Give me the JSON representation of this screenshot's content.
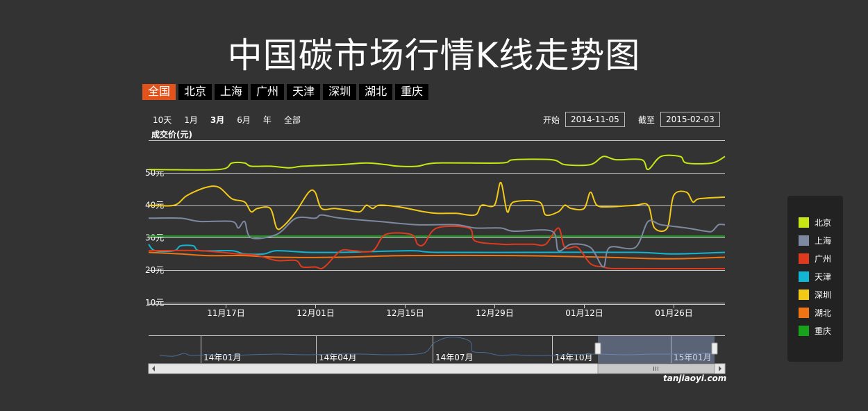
{
  "title": "中国碳市场行情K线走势图",
  "tabs": [
    "全国",
    "北京",
    "上海",
    "广州",
    "天津",
    "深圳",
    "湖北",
    "重庆"
  ],
  "active_tab": "全国",
  "ranges": [
    "10天",
    "1月",
    "3月",
    "6月",
    "年",
    "全部"
  ],
  "selected_range": "3月",
  "start_label": "开始",
  "start_date": "2014-11-05",
  "end_label": "截至",
  "end_date": "2015-02-03",
  "watermark": "tanjiaoyi.com",
  "chart_data": {
    "type": "line",
    "ylabel": "成交价(元)",
    "y_ticks": [
      10,
      20,
      30,
      40,
      50
    ],
    "y_tick_suffix": "元",
    "ylim": [
      10,
      60
    ],
    "xlim": [
      "2014-11-05",
      "2015-02-03"
    ],
    "x_ticks": [
      {
        "date": "2014-11-17",
        "label": "11月17日"
      },
      {
        "date": "2014-12-01",
        "label": "12月01日"
      },
      {
        "date": "2014-12-15",
        "label": "12月15日"
      },
      {
        "date": "2014-12-29",
        "label": "12月29日"
      },
      {
        "date": "2015-01-12",
        "label": "01月12日"
      },
      {
        "date": "2015-01-26",
        "label": "01月26日"
      }
    ],
    "grid": true,
    "legend_position": "right",
    "series": [
      {
        "name": "北京",
        "color": "#c8e614",
        "points": [
          [
            "2014-11-05",
            51
          ],
          [
            "2014-11-16",
            51
          ],
          [
            "2014-11-18",
            53
          ],
          [
            "2014-11-20",
            53
          ],
          [
            "2014-11-21",
            52
          ],
          [
            "2014-11-24",
            52
          ],
          [
            "2014-11-27",
            51.5
          ],
          [
            "2014-11-29",
            52
          ],
          [
            "2014-12-05",
            52.5
          ],
          [
            "2014-12-09",
            53
          ],
          [
            "2014-12-12",
            52.5
          ],
          [
            "2014-12-14",
            52
          ],
          [
            "2014-12-17",
            52
          ],
          [
            "2014-12-20",
            53
          ],
          [
            "2014-12-30",
            53
          ],
          [
            "2015-01-01",
            54
          ],
          [
            "2015-01-07",
            54
          ],
          [
            "2015-01-09",
            52.5
          ],
          [
            "2015-01-13",
            52.5
          ],
          [
            "2015-01-15",
            55
          ],
          [
            "2015-01-17",
            54
          ],
          [
            "2015-01-21",
            54
          ],
          [
            "2015-01-22",
            51
          ],
          [
            "2015-01-24",
            55
          ],
          [
            "2015-01-27",
            55
          ],
          [
            "2015-01-28",
            53
          ],
          [
            "2015-02-01",
            53
          ],
          [
            "2015-02-03",
            55
          ]
        ]
      },
      {
        "name": "上海",
        "color": "#7d89a1",
        "points": [
          [
            "2014-11-05",
            36
          ],
          [
            "2014-11-10",
            36
          ],
          [
            "2014-11-13",
            35
          ],
          [
            "2014-11-18",
            35
          ],
          [
            "2014-11-19",
            33
          ],
          [
            "2014-11-20",
            35
          ],
          [
            "2014-11-21",
            30
          ],
          [
            "2014-11-25",
            31
          ],
          [
            "2014-11-28",
            36
          ],
          [
            "2014-12-01",
            36
          ],
          [
            "2014-12-02",
            37
          ],
          [
            "2014-12-05",
            36
          ],
          [
            "2014-12-11",
            35
          ],
          [
            "2014-12-17",
            34
          ],
          [
            "2014-12-23",
            34
          ],
          [
            "2014-12-26",
            33
          ],
          [
            "2014-12-30",
            33
          ],
          [
            "2015-01-01",
            32
          ],
          [
            "2015-01-07",
            32
          ],
          [
            "2015-01-08",
            26
          ],
          [
            "2015-01-10",
            28
          ],
          [
            "2015-01-13",
            27
          ],
          [
            "2015-01-15",
            21
          ],
          [
            "2015-01-16",
            27
          ],
          [
            "2015-01-20",
            27
          ],
          [
            "2015-01-22",
            35
          ],
          [
            "2015-01-24",
            34
          ],
          [
            "2015-01-28",
            33
          ],
          [
            "2015-01-31",
            32
          ],
          [
            "2015-02-01",
            32
          ],
          [
            "2015-02-02",
            34
          ],
          [
            "2015-02-03",
            34
          ]
        ]
      },
      {
        "name": "广州",
        "color": "#e03a1e",
        "points": [
          [
            "2014-11-05",
            26
          ],
          [
            "2014-11-13",
            26
          ],
          [
            "2014-11-19",
            25
          ],
          [
            "2014-11-22",
            24.5
          ],
          [
            "2014-11-25",
            23
          ],
          [
            "2014-11-28",
            23
          ],
          [
            "2014-11-29",
            21
          ],
          [
            "2014-12-01",
            21
          ],
          [
            "2014-12-02",
            20.5
          ],
          [
            "2014-12-03",
            22
          ],
          [
            "2014-12-05",
            26
          ],
          [
            "2014-12-07",
            26
          ],
          [
            "2014-12-10",
            26
          ],
          [
            "2014-12-12",
            31
          ],
          [
            "2014-12-16",
            31
          ],
          [
            "2014-12-17",
            28
          ],
          [
            "2014-12-18",
            28
          ],
          [
            "2014-12-20",
            33
          ],
          [
            "2014-12-25",
            33
          ],
          [
            "2014-12-26",
            29
          ],
          [
            "2014-12-30",
            28
          ],
          [
            "2015-01-01",
            28
          ],
          [
            "2015-01-04",
            28
          ],
          [
            "2015-01-06",
            28
          ],
          [
            "2015-01-08",
            33
          ],
          [
            "2015-01-09",
            27
          ],
          [
            "2015-01-11",
            27
          ],
          [
            "2015-01-13",
            22
          ],
          [
            "2015-01-15",
            21
          ],
          [
            "2015-01-17",
            20.5
          ],
          [
            "2015-02-03",
            20.5
          ]
        ]
      },
      {
        "name": "天津",
        "color": "#12b5d2",
        "points": [
          [
            "2014-11-05",
            28
          ],
          [
            "2014-11-06",
            26
          ],
          [
            "2014-11-09",
            26
          ],
          [
            "2014-11-10",
            27.5
          ],
          [
            "2014-11-12",
            27.5
          ],
          [
            "2014-11-13",
            26
          ],
          [
            "2014-11-18",
            26
          ],
          [
            "2014-11-20",
            25
          ],
          [
            "2014-11-23",
            25
          ],
          [
            "2014-11-25",
            26
          ],
          [
            "2014-11-30",
            25.5
          ],
          [
            "2014-12-05",
            25.5
          ],
          [
            "2014-12-16",
            26
          ],
          [
            "2014-12-20",
            25.5
          ],
          [
            "2015-01-05",
            25.5
          ],
          [
            "2015-01-20",
            25.5
          ],
          [
            "2015-01-26",
            25
          ],
          [
            "2015-02-03",
            25.5
          ]
        ]
      },
      {
        "name": "深圳",
        "color": "#f3c918",
        "points": [
          [
            "2014-11-05",
            40
          ],
          [
            "2014-11-09",
            40
          ],
          [
            "2014-11-11",
            43
          ],
          [
            "2014-11-14",
            45.5
          ],
          [
            "2014-11-16",
            45.5
          ],
          [
            "2014-11-18",
            42
          ],
          [
            "2014-11-20",
            41
          ],
          [
            "2014-11-21",
            38
          ],
          [
            "2014-11-22",
            39
          ],
          [
            "2014-11-24",
            39
          ],
          [
            "2014-11-25",
            33
          ],
          [
            "2014-11-26",
            33.5
          ],
          [
            "2014-11-28",
            38
          ],
          [
            "2014-11-30",
            44
          ],
          [
            "2014-12-01",
            44
          ],
          [
            "2014-12-02",
            39
          ],
          [
            "2014-12-04",
            39
          ],
          [
            "2014-12-06",
            38.5
          ],
          [
            "2014-12-08",
            38
          ],
          [
            "2014-12-09",
            40
          ],
          [
            "2014-12-10",
            39
          ],
          [
            "2014-12-11",
            40
          ],
          [
            "2014-12-14",
            39.5
          ],
          [
            "2014-12-18",
            38
          ],
          [
            "2014-12-20",
            37.5
          ],
          [
            "2014-12-23",
            37.5
          ],
          [
            "2014-12-26",
            37
          ],
          [
            "2014-12-27",
            40
          ],
          [
            "2014-12-29",
            40
          ],
          [
            "2014-12-30",
            47
          ],
          [
            "2014-12-31",
            38
          ],
          [
            "2015-01-01",
            41
          ],
          [
            "2015-01-05",
            41
          ],
          [
            "2015-01-06",
            37
          ],
          [
            "2015-01-08",
            38
          ],
          [
            "2015-01-09",
            40
          ],
          [
            "2015-01-10",
            39
          ],
          [
            "2015-01-12",
            39
          ],
          [
            "2015-01-13",
            44
          ],
          [
            "2015-01-14",
            40
          ],
          [
            "2015-01-16",
            39.5
          ],
          [
            "2015-01-20",
            40
          ],
          [
            "2015-01-22",
            40
          ],
          [
            "2015-01-23",
            33
          ],
          [
            "2015-01-25",
            33
          ],
          [
            "2015-01-26",
            43
          ],
          [
            "2015-01-28",
            44
          ],
          [
            "2015-01-29",
            41
          ],
          [
            "2015-01-30",
            42
          ],
          [
            "2015-02-03",
            42.5
          ]
        ]
      },
      {
        "name": "湖北",
        "color": "#f07314",
        "points": [
          [
            "2014-11-05",
            25.5
          ],
          [
            "2014-11-10",
            25
          ],
          [
            "2014-11-14",
            24.5
          ],
          [
            "2014-11-20",
            24.5
          ],
          [
            "2014-11-25",
            24
          ],
          [
            "2014-12-05",
            24
          ],
          [
            "2014-12-15",
            24.5
          ],
          [
            "2015-01-01",
            24.5
          ],
          [
            "2015-01-15",
            24
          ],
          [
            "2015-01-25",
            23.5
          ],
          [
            "2015-02-03",
            24
          ]
        ]
      },
      {
        "name": "重庆",
        "color": "#18a11a",
        "points": [
          [
            "2014-11-05",
            30.5
          ],
          [
            "2015-02-03",
            30.5
          ]
        ]
      }
    ],
    "navigator": {
      "labels": [
        "14年01月",
        "14年04月",
        "14年07月",
        "14年10月",
        "15年01月"
      ]
    }
  }
}
